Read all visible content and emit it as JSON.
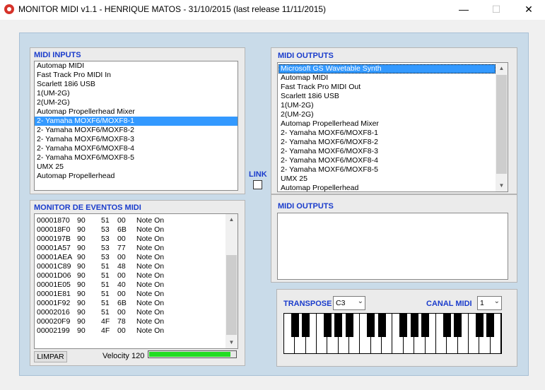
{
  "window": {
    "title": "MONITOR MIDI v1.1 - HENRIQUE MATOS - 31/10/2015 (last release 11/11/2015)",
    "minimize": "—",
    "maximize": "☐",
    "close": "✕"
  },
  "midi_inputs": {
    "title": "MIDI INPUTS",
    "items": [
      "Automap MIDI",
      "Fast Track Pro MIDI In",
      "Scarlett 18i6 USB",
      "1(UM-2G)",
      "2(UM-2G)",
      "Automap Propellerhead Mixer",
      "2- Yamaha MOXF6/MOXF8-1",
      "2- Yamaha MOXF6/MOXF8-2",
      "2- Yamaha MOXF6/MOXF8-3",
      "2- Yamaha MOXF6/MOXF8-4",
      "2- Yamaha MOXF6/MOXF8-5",
      "UMX 25",
      "Automap Propellerhead"
    ],
    "selected_index": 6
  },
  "midi_outputs": {
    "title": "MIDI OUTPUTS",
    "items": [
      "Microsoft GS Wavetable Synth",
      "Automap MIDI",
      "Fast Track Pro MIDI Out",
      "Scarlett 18i6 USB",
      "1(UM-2G)",
      "2(UM-2G)",
      "Automap Propellerhead Mixer",
      "2- Yamaha MOXF6/MOXF8-1",
      "2- Yamaha MOXF6/MOXF8-2",
      "2- Yamaha MOXF6/MOXF8-3",
      "2- Yamaha MOXF6/MOXF8-4",
      "2- Yamaha MOXF6/MOXF8-5",
      "UMX 25",
      "Automap Propellerhead"
    ],
    "selected_index": 0
  },
  "link": {
    "label": "LINK",
    "checked": false
  },
  "monitor": {
    "title": "MONITOR DE EVENTOS MIDI",
    "events": [
      {
        "time": "00001870",
        "status": "90",
        "data1": "51",
        "data2": "00",
        "type": "Note On"
      },
      {
        "time": "000018F0",
        "status": "90",
        "data1": "53",
        "data2": "6B",
        "type": "Note On"
      },
      {
        "time": "0000197B",
        "status": "90",
        "data1": "53",
        "data2": "00",
        "type": "Note On"
      },
      {
        "time": "00001A57",
        "status": "90",
        "data1": "53",
        "data2": "77",
        "type": "Note On"
      },
      {
        "time": "00001AEA",
        "status": "90",
        "data1": "53",
        "data2": "00",
        "type": "Note On"
      },
      {
        "time": "00001C89",
        "status": "90",
        "data1": "51",
        "data2": "48",
        "type": "Note On"
      },
      {
        "time": "00001D06",
        "status": "90",
        "data1": "51",
        "data2": "00",
        "type": "Note On"
      },
      {
        "time": "00001E05",
        "status": "90",
        "data1": "51",
        "data2": "40",
        "type": "Note On"
      },
      {
        "time": "00001E81",
        "status": "90",
        "data1": "51",
        "data2": "00",
        "type": "Note On"
      },
      {
        "time": "00001F92",
        "status": "90",
        "data1": "51",
        "data2": "6B",
        "type": "Note On"
      },
      {
        "time": "00002016",
        "status": "90",
        "data1": "51",
        "data2": "00",
        "type": "Note On"
      },
      {
        "time": "000020F9",
        "status": "90",
        "data1": "4F",
        "data2": "78",
        "type": "Note On"
      },
      {
        "time": "00002199",
        "status": "90",
        "data1": "4F",
        "data2": "00",
        "type": "Note On"
      }
    ],
    "clear_button": "LIMPAR",
    "velocity_label": "Velocity",
    "velocity_value": "120",
    "velocity_fraction": 0.94
  },
  "midi_outputs_panel2": {
    "title": "MIDI OUTPUTS"
  },
  "transpose": {
    "label": "TRANSPOSE",
    "value": "C3"
  },
  "canal_midi": {
    "label": "CANAL MIDI",
    "value": "1"
  },
  "icons": {
    "app": "app-icon",
    "scroll_up": "▲",
    "scroll_down": "▼",
    "combo_arrow": "⌄"
  },
  "colors": {
    "title_blue": "#1a3ccc",
    "selection": "#3399ff",
    "velocity_green": "#22dd22"
  }
}
